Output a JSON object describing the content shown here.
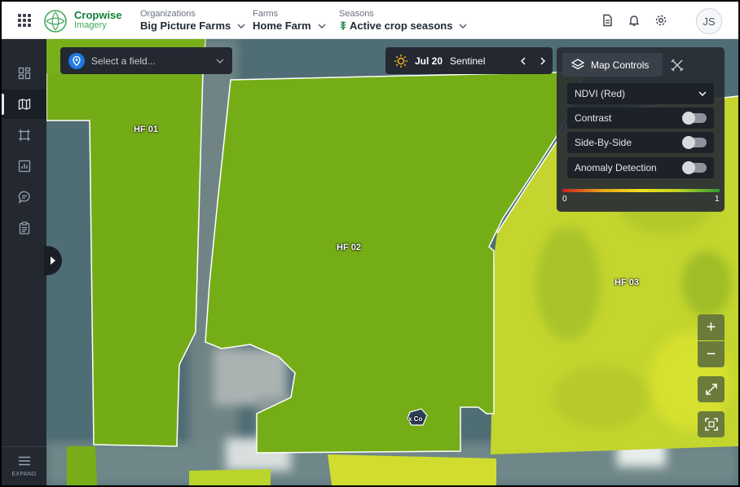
{
  "header": {
    "brand_name": "Cropwise",
    "brand_sub": "Imagery",
    "organizations": {
      "label": "Organizations",
      "value": "Big Picture Farms"
    },
    "farms": {
      "label": "Farms",
      "value": "Home Farm"
    },
    "seasons": {
      "label": "Seasons",
      "value": "Active crop seasons"
    },
    "avatar_initials": "JS"
  },
  "sidenav": {
    "items": [
      {
        "icon": "dashboard-icon"
      },
      {
        "icon": "map-icon",
        "active": true
      },
      {
        "icon": "crop-area-icon"
      },
      {
        "icon": "chart-icon"
      },
      {
        "icon": "comment-icon"
      },
      {
        "icon": "clipboard-icon"
      }
    ],
    "expand_label": "EXPAND"
  },
  "field_select": {
    "placeholder": "Select a field..."
  },
  "date_bar": {
    "date": "Jul 20",
    "source": "Sentinel"
  },
  "map_controls": {
    "tab_label": "Map Controls",
    "layer_select": "NDVI (Red)",
    "toggles": [
      {
        "label": "Contrast",
        "on": false
      },
      {
        "label": "Side-By-Side",
        "on": false
      },
      {
        "label": "Anomaly Detection",
        "on": false
      }
    ],
    "legend_min": "0",
    "legend_max": "1"
  },
  "map": {
    "fields": [
      {
        "label": "HF 01"
      },
      {
        "label": "HF 02"
      },
      {
        "label": "HF 03"
      }
    ],
    "marker_label": "x Co"
  },
  "zoom": {
    "in": "+",
    "out": "−"
  },
  "colors": {
    "brand": "#14803c",
    "panel": "#232831",
    "ndvi_high": "#7cb518",
    "ndvi_mid": "#c7dd2a",
    "map_button": "#6b7c3a"
  }
}
